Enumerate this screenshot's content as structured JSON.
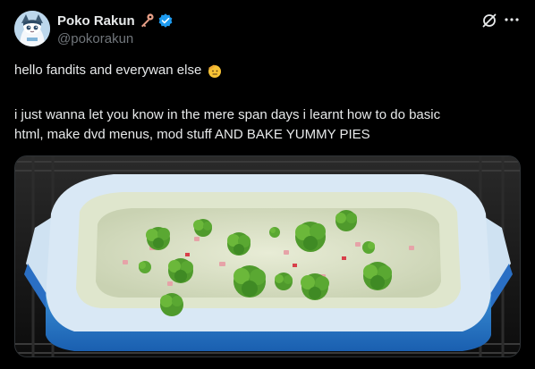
{
  "post": {
    "author": {
      "display_name": "Poko Rakun",
      "handle": "@pokorakun",
      "badge_icons": [
        "key-icon",
        "verified-icon"
      ],
      "verified_color": "#1d9bf0"
    },
    "text": {
      "line1": "hello fandits and everywan else",
      "line1_emoji": "saluting-face-emoji",
      "line2": "i just wanna let you know in the mere span days i learnt how to do basic",
      "line3": "html, make dvd menus, mod stuff AND BAKE YUMMY PIES"
    },
    "header_actions": [
      "grok-icon",
      "more-icon"
    ],
    "media": {
      "type": "photo",
      "subject": "quiche with broccoli and ham in a blue ceramic baking dish inside an oven"
    }
  },
  "colors": {
    "background": "#000000",
    "text_primary": "#e7e9ea",
    "text_secondary": "#71767b",
    "accent": "#1d9bf0"
  }
}
